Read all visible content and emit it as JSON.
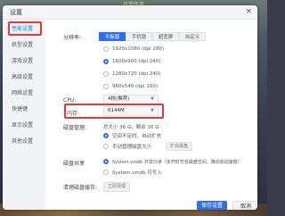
{
  "background": {
    "top_text": "日常任务"
  },
  "window": {
    "title": "设置",
    "close_glyph": "×"
  },
  "sidebar": {
    "items": [
      {
        "label": "性能设置"
      },
      {
        "label": "机型设置"
      },
      {
        "label": "游戏设置"
      },
      {
        "label": "高级设置"
      },
      {
        "label": "网络设置"
      },
      {
        "label": "快捷键"
      },
      {
        "label": "显示设置"
      },
      {
        "label": "其他设置"
      }
    ]
  },
  "resolution": {
    "label": "分辨率:",
    "tabs": [
      "平板版",
      "手机版",
      "超宽屏",
      "自定义"
    ],
    "options": [
      "1920x1080 (dpi 280)",
      "1600x900 (dpi 240)",
      "1280x720 (dpi 240)",
      "960x540 (dpi 160)"
    ]
  },
  "cpu": {
    "label": "CPU:",
    "value": "4核(推荐)"
  },
  "memory": {
    "label": "内存:",
    "value": "6144M"
  },
  "disk": {
    "label": "磁盘管理:",
    "summary": "总大小 36 G，剩余 16 G",
    "options": [
      "空间不足时，自动扩充",
      "手动管理磁盘大小"
    ],
    "expand_button": "扩充磁盘"
  },
  "disk_share": {
    "label": "磁盘共享",
    "options": [
      "System.vmdk 共享只读（多开时节省磁盘空间，降低启动速度）",
      "System.vmdk 可写入"
    ]
  },
  "clean": {
    "label": "清理磁盘缓存:",
    "button": "立即清理"
  },
  "footer": {
    "save": "保存设置",
    "cancel": "取消"
  },
  "colors": {
    "accent": "#2c6ef2",
    "highlight": "#e53935"
  }
}
